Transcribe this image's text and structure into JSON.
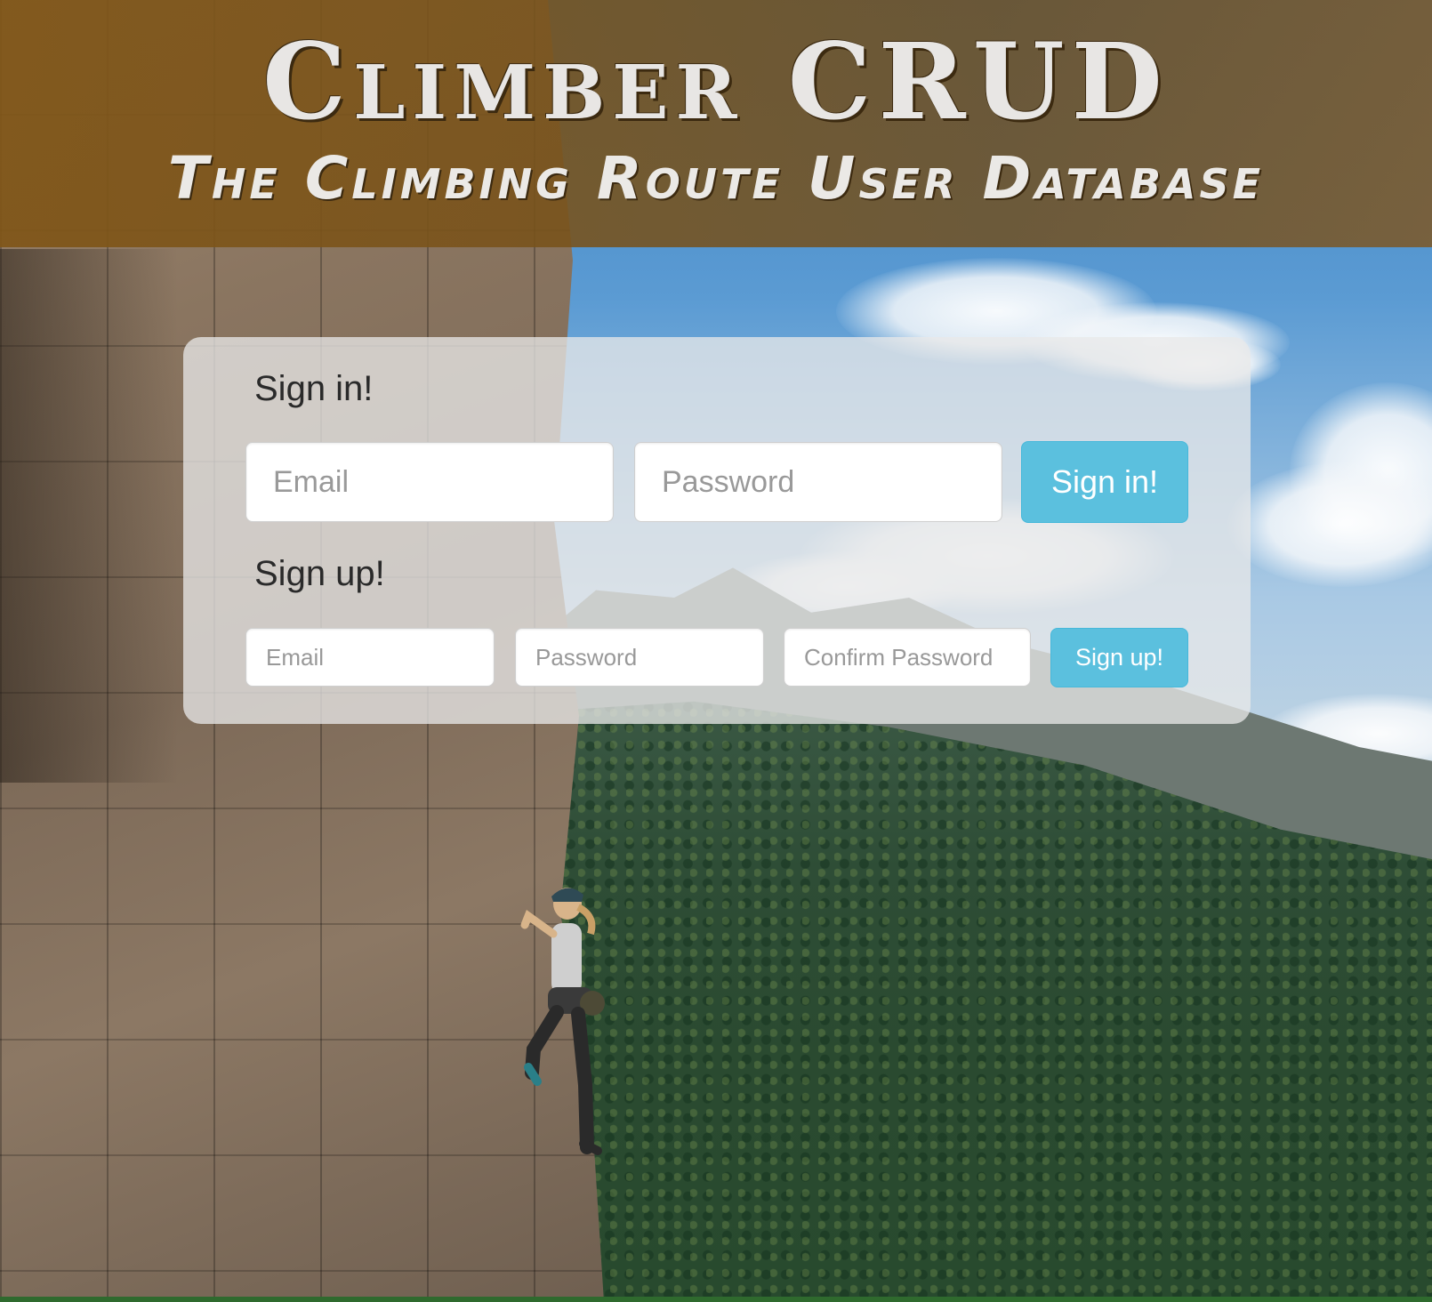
{
  "header": {
    "title": "Climber CRUD",
    "subtitle": "The Climbing Route User Database"
  },
  "sign_in": {
    "heading": "Sign in!",
    "email_placeholder": "Email",
    "email_value": "",
    "password_placeholder": "Password",
    "password_value": "",
    "submit_label": "Sign in!"
  },
  "sign_up": {
    "heading": "Sign up!",
    "email_placeholder": "Email",
    "email_value": "",
    "password_placeholder": "Password",
    "password_value": "",
    "confirm_placeholder": "Confirm Password",
    "confirm_value": "",
    "submit_label": "Sign up!"
  },
  "colors": {
    "button": "#5bc0de",
    "banner": "#7f5818",
    "panel": "#e8e8e8"
  }
}
